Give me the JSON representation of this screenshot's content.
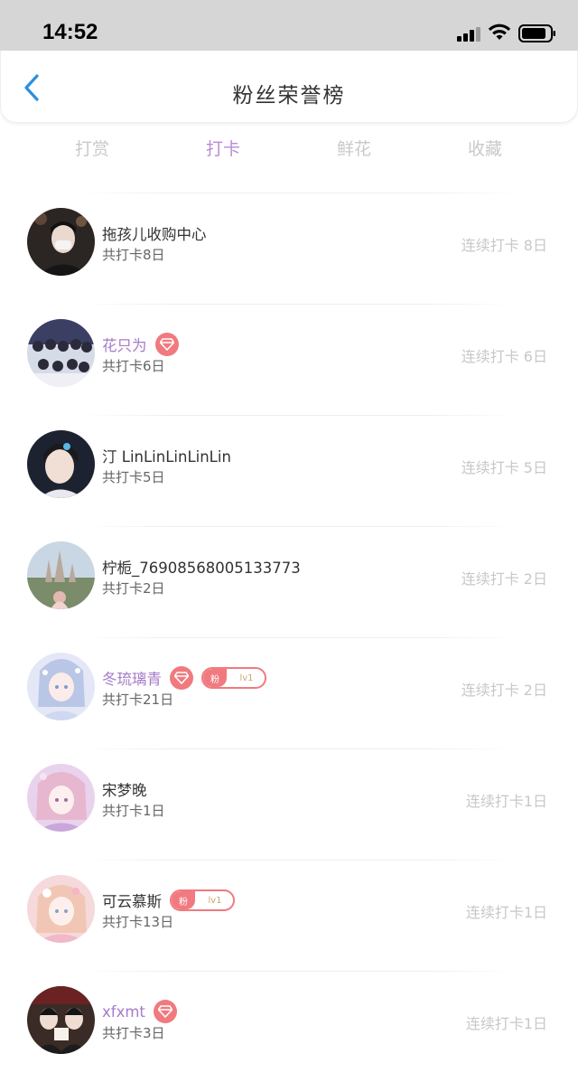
{
  "status_bar": {
    "time": "14:52"
  },
  "header": {
    "title": "粉丝荣誉榜"
  },
  "tabs": [
    {
      "label": "打赏",
      "active": false
    },
    {
      "label": "打卡",
      "active": true
    },
    {
      "label": "鲜花",
      "active": false
    },
    {
      "label": "收藏",
      "active": false
    }
  ],
  "colors": {
    "accent": "#b98bd6",
    "vip_name": "#a67bc9",
    "badge": "#f07a7f",
    "muted": "#c8c8c8"
  },
  "fans": [
    {
      "name": "拖孩儿收购中心",
      "total": "共打卡8日",
      "streak": "连续打卡 8日",
      "vip": false,
      "diamond": false,
      "fan_badge": null,
      "avatar": "avatar-dark-masked"
    },
    {
      "name": "花只为",
      "total": "共打卡6日",
      "streak": "连续打卡 6日",
      "vip": true,
      "diamond": true,
      "fan_badge": null,
      "avatar": "avatar-group-photo"
    },
    {
      "name": "汀 LinLinLinLinLin",
      "total": "共打卡5日",
      "streak": "连续打卡 5日",
      "vip": false,
      "diamond": false,
      "fan_badge": null,
      "avatar": "avatar-boy"
    },
    {
      "name": "柠栀_76908568005133773",
      "total": "共打卡2日",
      "streak": "连续打卡 2日",
      "vip": false,
      "diamond": false,
      "fan_badge": null,
      "avatar": "avatar-castle"
    },
    {
      "name": "冬琉璃青",
      "total": "共打卡21日",
      "streak": "连续打卡 2日",
      "vip": true,
      "diamond": true,
      "fan_badge": {
        "left": "粉",
        "level": "lv1"
      },
      "avatar": "avatar-anime-blue"
    },
    {
      "name": "宋梦晚",
      "total": "共打卡1日",
      "streak": "连续打卡1日",
      "vip": false,
      "diamond": false,
      "fan_badge": null,
      "avatar": "avatar-anime-pink"
    },
    {
      "name": "可云慕斯",
      "total": "共打卡13日",
      "streak": "连续打卡1日",
      "vip": false,
      "diamond": false,
      "fan_badge": {
        "left": "粉",
        "level": "lv1"
      },
      "avatar": "avatar-anime-flower"
    },
    {
      "name": "xfxmt",
      "total": "共打卡3日",
      "streak": "连续打卡1日",
      "vip": true,
      "diamond": true,
      "fan_badge": null,
      "avatar": "avatar-two-people"
    }
  ]
}
